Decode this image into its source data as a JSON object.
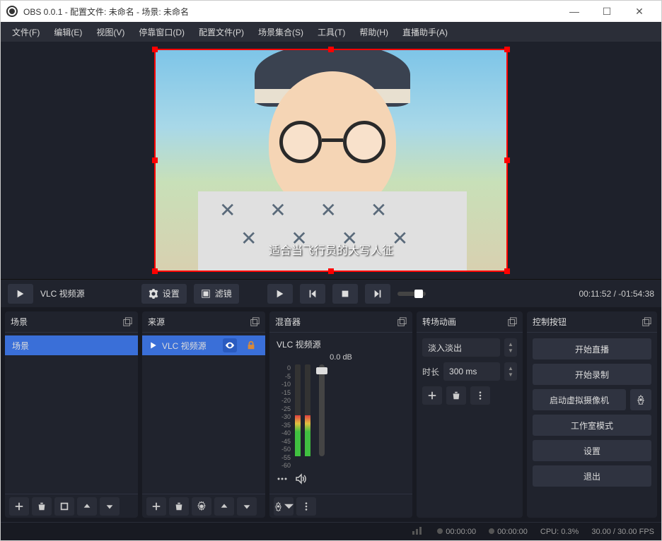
{
  "window": {
    "title": "OBS 0.0.1 - 配置文件: 未命名 - 场景: 未命名"
  },
  "menu": {
    "file": "文件(F)",
    "edit": "编辑(E)",
    "view": "视图(V)",
    "dock": "停靠窗口(D)",
    "profile": "配置文件(P)",
    "scenes": "场景集合(S)",
    "tools": "工具(T)",
    "help": "帮助(H)",
    "assist": "直播助手(A)"
  },
  "preview": {
    "subtitle": "适合当飞行员的大写人征"
  },
  "controlbar": {
    "source_label": "VLC 视频源",
    "settings": "设置",
    "filters": "滤镜",
    "time_elapsed": "00:11:52",
    "time_sep": " / ",
    "time_total": "-01:54:38"
  },
  "panels": {
    "scenes": {
      "title": "场景",
      "items": [
        "场景"
      ]
    },
    "sources": {
      "title": "来源",
      "items": [
        {
          "label": "VLC 视频源"
        }
      ]
    },
    "mixer": {
      "title": "混音器",
      "source": "VLC 视频源",
      "db": "0.0 dB",
      "scale": [
        "0",
        "-5",
        "-10",
        "-15",
        "-20",
        "-25",
        "-30",
        "-35",
        "-40",
        "-45",
        "-50",
        "-55",
        "-60"
      ]
    },
    "transitions": {
      "title": "转场动画",
      "selected": "淡入淡出",
      "duration_label": "时长",
      "duration_value": "300 ms"
    },
    "controls": {
      "title": "控制按钮",
      "start_stream": "开始直播",
      "start_record": "开始录制",
      "start_vcam": "启动虚拟摄像机",
      "studio": "工作室模式",
      "settings": "设置",
      "exit": "退出"
    }
  },
  "statusbar": {
    "net_time": "00:00:00",
    "rec_time": "00:00:00",
    "cpu": "CPU: 0.3%",
    "fps": "30.00 / 30.00 FPS"
  }
}
